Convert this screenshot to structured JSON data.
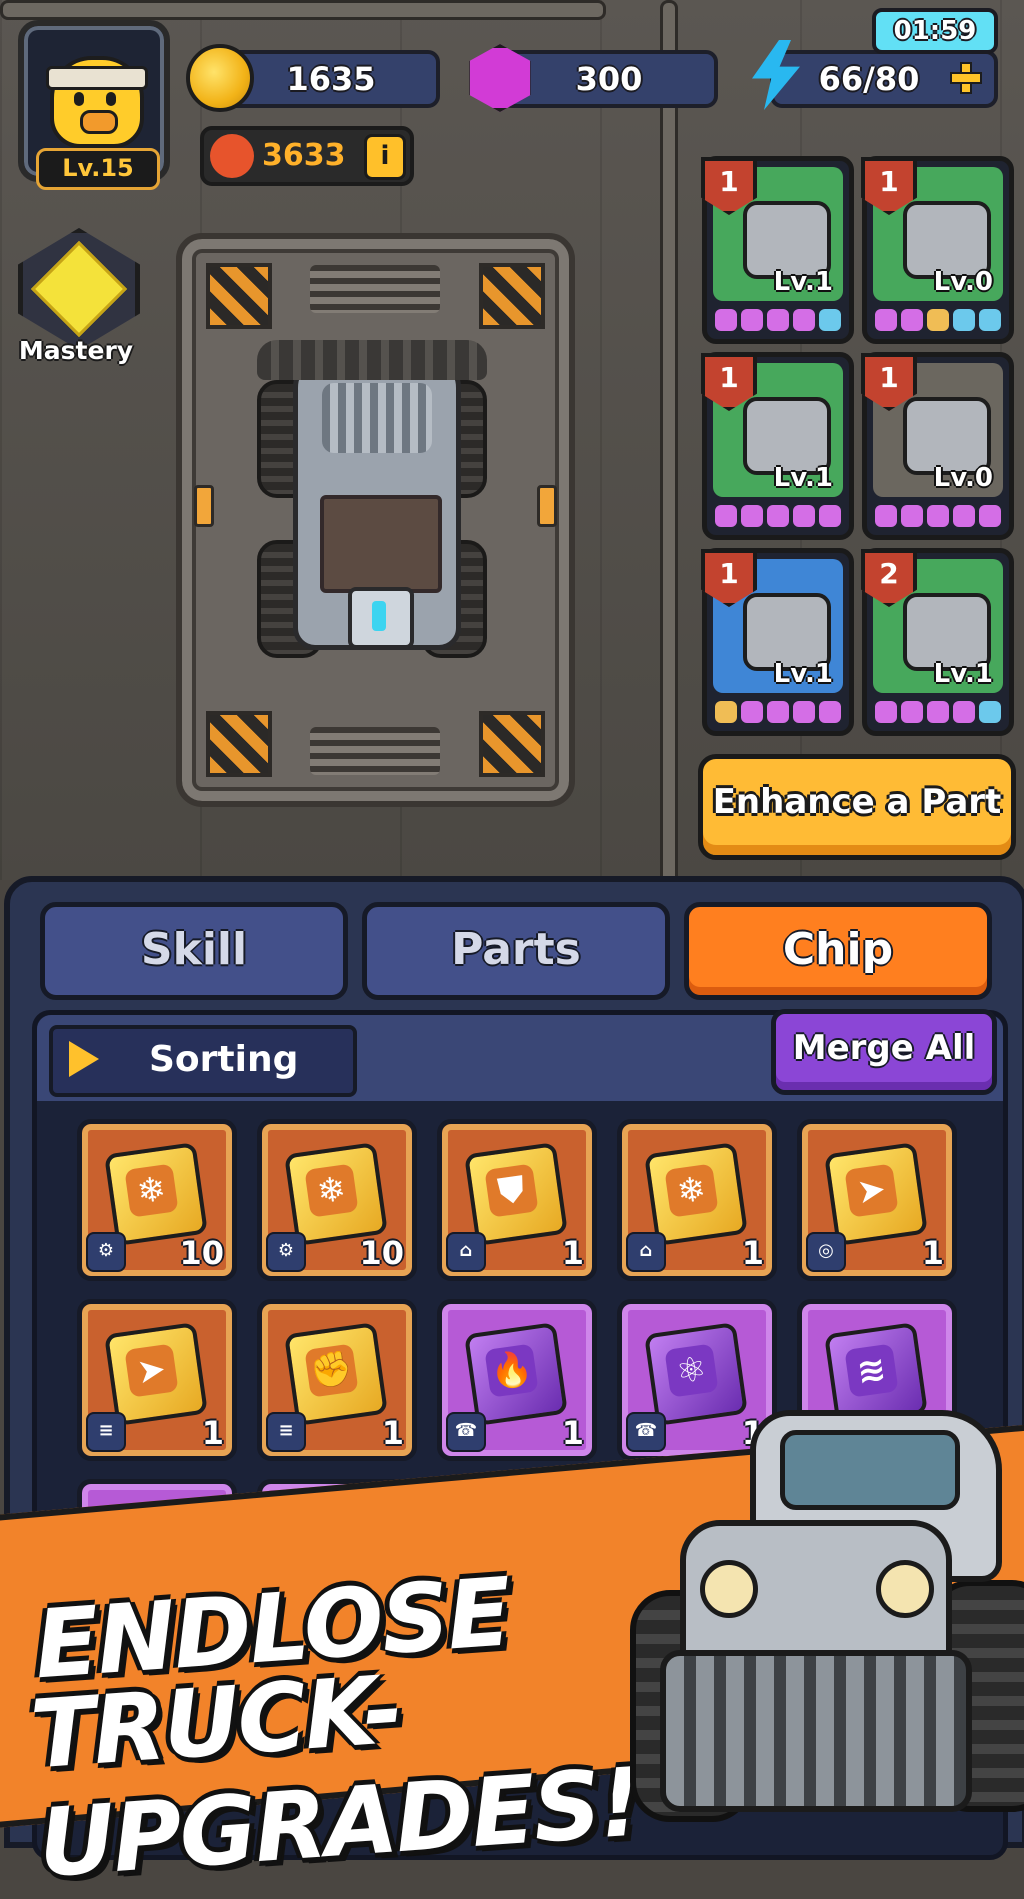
{
  "hud": {
    "timer": "01:59",
    "player_level": "Lv.15",
    "coins": "1635",
    "gems": "300",
    "energy": "66/80",
    "power": "3633",
    "info_label": "i",
    "mastery_label": "Mastery"
  },
  "parts": [
    {
      "count": "1",
      "level": "Lv.1",
      "color": "green",
      "icon": "engine-icon",
      "pips": [
        "p",
        "p",
        "p",
        "p",
        "c"
      ]
    },
    {
      "count": "1",
      "level": "Lv.0",
      "color": "green",
      "icon": "tire-icon",
      "pips": [
        "p",
        "p",
        "y",
        "c",
        "c"
      ]
    },
    {
      "count": "1",
      "level": "Lv.1",
      "color": "green",
      "icon": "spike-ram-icon",
      "pips": [
        "p",
        "p",
        "p",
        "p",
        "p"
      ]
    },
    {
      "count": "1",
      "level": "Lv.0",
      "color": "gray",
      "icon": "exhaust-icon",
      "pips": [
        "p",
        "p",
        "p",
        "p",
        "p"
      ]
    },
    {
      "count": "1",
      "level": "Lv.1",
      "color": "blue",
      "icon": "fuel-tank-icon",
      "pips": [
        "y",
        "p",
        "p",
        "p",
        "p"
      ]
    },
    {
      "count": "2",
      "level": "Lv.1",
      "color": "green",
      "icon": "suspension-icon",
      "pips": [
        "p",
        "p",
        "p",
        "p",
        "c"
      ]
    }
  ],
  "enhance_button": "Enhance a Part",
  "tabs": [
    "Skill",
    "Parts",
    "Chip"
  ],
  "active_tab": "Chip",
  "sorting_label": "Sorting",
  "merge_all_label": "Merge All",
  "chips": [
    {
      "rarity": "gold",
      "glyph": "❄",
      "icon": "snowflake-icon",
      "slot": "⚙",
      "qty": "10"
    },
    {
      "rarity": "gold",
      "glyph": "❄",
      "icon": "snowflake-icon",
      "slot": "⚙",
      "qty": "10"
    },
    {
      "rarity": "gold",
      "glyph": "⛊",
      "icon": "shield-icon",
      "slot": "⌂",
      "qty": "1"
    },
    {
      "rarity": "gold",
      "glyph": "❄",
      "icon": "snowflake-icon",
      "slot": "⌂",
      "qty": "1"
    },
    {
      "rarity": "gold",
      "glyph": "➤",
      "icon": "bullet-icon",
      "slot": "◎",
      "qty": "1"
    },
    {
      "rarity": "gold",
      "glyph": "➤",
      "icon": "bullet-icon",
      "slot": "≡",
      "qty": "1"
    },
    {
      "rarity": "gold",
      "glyph": "✊",
      "icon": "fist-icon",
      "slot": "≡",
      "qty": "1"
    },
    {
      "rarity": "purple",
      "glyph": "🔥",
      "icon": "fire-icon",
      "slot": "☎",
      "qty": "1"
    },
    {
      "rarity": "purple",
      "glyph": "⚛",
      "icon": "atom-icon",
      "slot": "☎",
      "qty": "1"
    },
    {
      "rarity": "purple",
      "glyph": "≋",
      "icon": "tornado-icon",
      "slot": "",
      "qty": ""
    },
    {
      "rarity": "purple",
      "glyph": "❄",
      "icon": "snowflake-icon",
      "slot": "",
      "qty": ""
    },
    {
      "rarity": "purple",
      "glyph": "⛊",
      "icon": "shield-icon",
      "slot": "",
      "qty": ""
    },
    {
      "rarity": "purple",
      "glyph": "●",
      "icon": "orb-icon",
      "slot": "",
      "qty": ""
    },
    {
      "rarity": "purple",
      "glyph": "◆",
      "icon": "gem-chip-icon",
      "slot": "",
      "qty": ""
    }
  ],
  "promo": {
    "line1": "ENDLOSE",
    "line2": "TRUCK-UPGRADES!"
  },
  "colors": {
    "accent_orange": "#ff7f1f",
    "merge_purple": "#8b46d6",
    "enhance_yellow": "#ffbb35",
    "panel_navy": "#2b3552"
  }
}
